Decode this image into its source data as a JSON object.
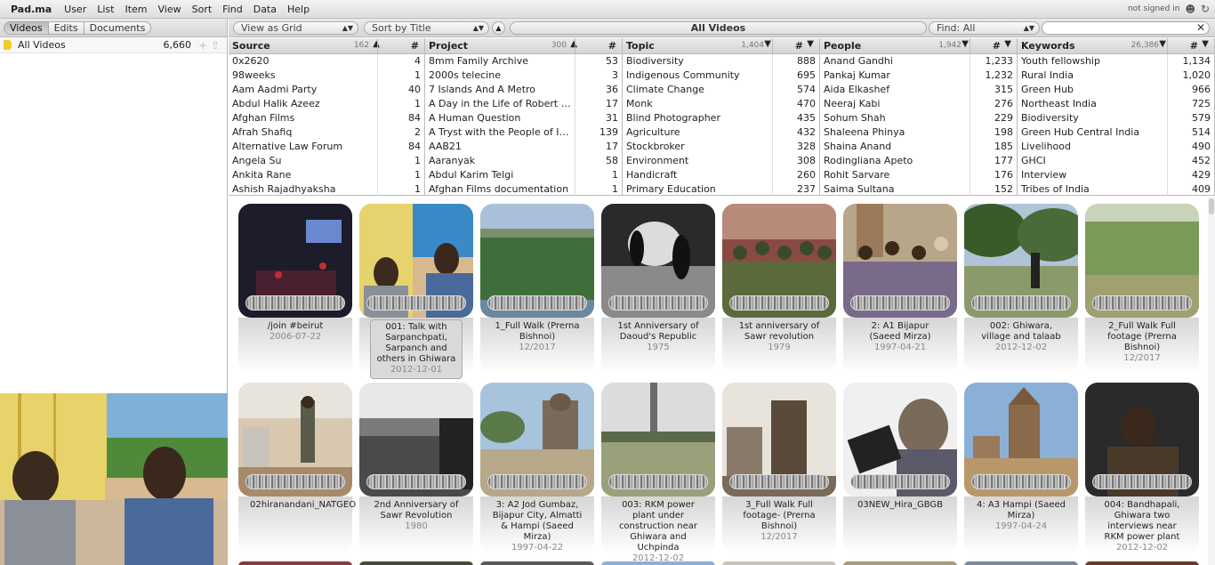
{
  "app": {
    "logo": "Pad.ma",
    "status": "not signed in"
  },
  "menu": [
    "User",
    "List",
    "Item",
    "View",
    "Sort",
    "Find",
    "Data",
    "Help"
  ],
  "sections": [
    "Videos",
    "Edits",
    "Documents"
  ],
  "list": {
    "name": "All Videos",
    "count": "6,660"
  },
  "toolbar": {
    "view": "View as Grid",
    "sort": "Sort by Title",
    "title": "All Videos",
    "find": "Find: All",
    "search_value": ""
  },
  "browser": [
    {
      "key": "source",
      "title": "Source",
      "count": "162",
      "sort": "▲",
      "rows": [
        [
          "0x2620",
          "4"
        ],
        [
          "98weeks",
          "1"
        ],
        [
          "Aam Aadmi Party",
          "40"
        ],
        [
          "Abdul Halik Azeez",
          "1"
        ],
        [
          "Afghan Films",
          "84"
        ],
        [
          "Afrah Shafiq",
          "2"
        ],
        [
          "Alternative Law Forum",
          "84"
        ],
        [
          "Angela Su",
          "1"
        ],
        [
          "Ankita Rane",
          "1"
        ],
        [
          "Ashish Rajadhyaksha",
          "1"
        ]
      ]
    },
    {
      "key": "project",
      "title": "Project",
      "count": "300",
      "sort": "▲",
      "rows": [
        [
          "8mm Family Archive",
          "53"
        ],
        [
          "2000s telecine",
          "3"
        ],
        [
          "7 Islands And A Metro",
          "36"
        ],
        [
          "A Day in the Life of Robert Lux...",
          "17"
        ],
        [
          "A Human Question",
          "31"
        ],
        [
          "A Tryst with the People of India",
          "139"
        ],
        [
          "AAB21",
          "17"
        ],
        [
          "Aaranyak",
          "58"
        ],
        [
          "Abdul Karim Telgi",
          "1"
        ],
        [
          "Afghan Films documentation",
          "1"
        ]
      ]
    },
    {
      "key": "topic",
      "title": "Topic",
      "count": "1,404",
      "sort": "▼",
      "rows": [
        [
          "Biodiversity",
          "888"
        ],
        [
          "Indigenous Community",
          "695"
        ],
        [
          "Climate Change",
          "574"
        ],
        [
          "Monk",
          "470"
        ],
        [
          "Blind Photographer",
          "435"
        ],
        [
          "Agriculture",
          "432"
        ],
        [
          "Stockbroker",
          "328"
        ],
        [
          "Environment",
          "308"
        ],
        [
          "Handicraft",
          "260"
        ],
        [
          "Primary Education",
          "237"
        ]
      ]
    },
    {
      "key": "people",
      "title": "People",
      "count": "1,942",
      "sort": "▼",
      "rows": [
        [
          "Anand Gandhi",
          "1,233"
        ],
        [
          "Pankaj Kumar",
          "1,232"
        ],
        [
          "Aida Elkashef",
          "315"
        ],
        [
          "Neeraj Kabi",
          "276"
        ],
        [
          "Sohum Shah",
          "229"
        ],
        [
          "Shaleena Phinya",
          "198"
        ],
        [
          "Shaina Anand",
          "185"
        ],
        [
          "Rodingliana Apeto",
          "177"
        ],
        [
          "Rohit Sarvare",
          "176"
        ],
        [
          "Saima Sultana",
          "152"
        ]
      ]
    },
    {
      "key": "keywords",
      "title": "Keywords",
      "count": "26,386",
      "sort": "▼",
      "rows": [
        [
          "Youth fellowship",
          "1,134"
        ],
        [
          "Rural India",
          "1,020"
        ],
        [
          "Green Hub",
          "966"
        ],
        [
          "Northeast India",
          "725"
        ],
        [
          "Biodiversity",
          "579"
        ],
        [
          "Green Hub Central India",
          "514"
        ],
        [
          "Livelihood",
          "490"
        ],
        [
          "GHCI",
          "452"
        ],
        [
          "Interview",
          "429"
        ],
        [
          "Tribes of India",
          "409"
        ]
      ]
    }
  ],
  "items": [
    {
      "title": "/join #beirut",
      "date": "2006-07-22",
      "scene": "stage",
      "selected": false
    },
    {
      "title": "001: Talk with Sarpanchpati, Sarpanch and others in Ghiwara",
      "date": "2012-12-01",
      "scene": "people",
      "selected": true
    },
    {
      "title": "1_Full Walk (Prerna Bishnoi)",
      "date": "12/2017",
      "scene": "water",
      "selected": false
    },
    {
      "title": "1st Anniversary of Daoud's Republic",
      "date": "1975",
      "scene": "bw",
      "selected": false
    },
    {
      "title": "1st anniversary of Sawr revolution",
      "date": "1979",
      "scene": "crowd-red",
      "selected": false
    },
    {
      "title": "2: A1 Bijapur (Saeed Mirza)",
      "date": "1997-04-21",
      "scene": "crowd",
      "selected": false
    },
    {
      "title": "002: Ghiwara, village and talaab",
      "date": "2012-12-02",
      "scene": "trees",
      "selected": false
    },
    {
      "title": "2_Full Walk Full footage (Prerna Bishnoi)",
      "date": "12/2017",
      "scene": "grass",
      "selected": false
    },
    {
      "title": "02hiranandani_NATGEO",
      "date": "",
      "scene": "outdoor",
      "selected": false
    },
    {
      "title": "2nd Anniversary of Sawr Revolution",
      "date": "1980",
      "scene": "bw2",
      "selected": false
    },
    {
      "title": "3: A2 Jod Gumbaz, Bijapur City, Almatti & Hampi (Saeed Mirza)",
      "date": "1997-04-22",
      "scene": "monument",
      "selected": false
    },
    {
      "title": "003: RKM power plant under construction near Ghiwara and Uchpinda",
      "date": "2012-12-02",
      "scene": "field",
      "selected": false
    },
    {
      "title": "3_Full Walk Full footage- (Prerna Bishnoi)",
      "date": "12/2017",
      "scene": "building",
      "selected": false
    },
    {
      "title": "03NEW_Hira_GBGB",
      "date": "",
      "scene": "speaker",
      "selected": false
    },
    {
      "title": "4: A3 Hampi (Saeed Mirza)",
      "date": "1997-04-24",
      "scene": "temple",
      "selected": false
    },
    {
      "title": "004: Bandhapali, Ghiwara two interviews near RKM power plant",
      "date": "2012-12-02",
      "scene": "man",
      "selected": false
    }
  ],
  "colors": {
    "accent": "#f2cc24",
    "toolbar": "#dedede"
  }
}
